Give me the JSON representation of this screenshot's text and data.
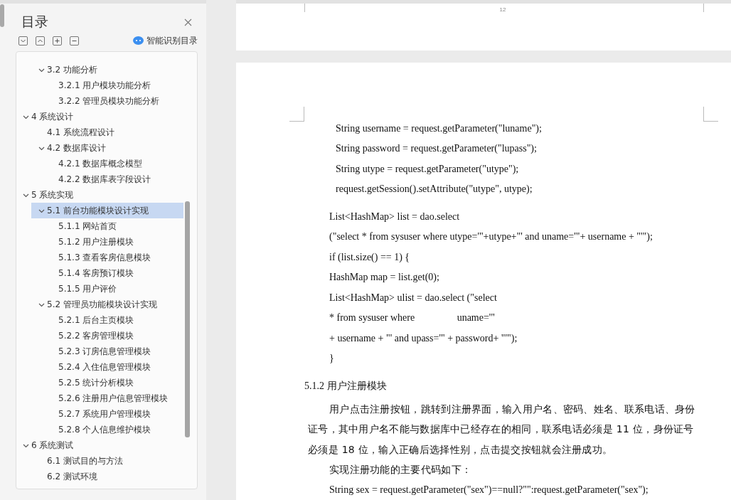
{
  "sidebar": {
    "title": "目录",
    "smart_button": "智能识别目录",
    "toc_continued": [
      {
        "label": "3.2 功能分析",
        "expanded": true,
        "selected": false,
        "children": [
          {
            "label": "3.2.1  用户模块功能分析",
            "selected": false
          },
          {
            "label": "3.2.2  管理员模块功能分析",
            "selected": false
          }
        ]
      }
    ],
    "toc": [
      {
        "label": "4 系统设计",
        "expanded": true,
        "selected": false,
        "children": [
          {
            "label": "4.1 系统流程设计",
            "selected": false
          },
          {
            "label": "4.2 数据库设计",
            "expanded": true,
            "selected": false,
            "children": [
              {
                "label": "4.2.1  数据库概念模型",
                "selected": false
              },
              {
                "label": "4.2.2  数据库表字段设计",
                "selected": false
              }
            ]
          }
        ]
      },
      {
        "label": "5 系统实现",
        "expanded": true,
        "selected": false,
        "children": [
          {
            "label": "5.1  前台功能模块设计实现",
            "expanded": true,
            "selected": true,
            "children": [
              {
                "label": "5.1.1 网站首页",
                "selected": false
              },
              {
                "label": "5.1.2 用户注册模块",
                "selected": false
              },
              {
                "label": "5.1.3 查看客房信息模块",
                "selected": false
              },
              {
                "label": "5.1.4 客房预订模块",
                "selected": false
              },
              {
                "label": "5.1.5 用户评价",
                "selected": false
              }
            ]
          },
          {
            "label": "5.2  管理员功能模块设计实现",
            "expanded": true,
            "selected": false,
            "children": [
              {
                "label": "5.2.1  后台主页模块",
                "selected": false
              },
              {
                "label": "5.2.2  客房管理模块",
                "selected": false
              },
              {
                "label": "5.2.3  订房信息管理模块",
                "selected": false
              },
              {
                "label": "5.2.4  入住信息管理模块",
                "selected": false
              },
              {
                "label": "5.2.5 统计分析模块",
                "selected": false
              },
              {
                "label": "5.2.6 注册用户信息管理模块",
                "selected": false
              },
              {
                "label": "5.2.7 系统用户管理模块",
                "selected": false
              },
              {
                "label": "5.2.8 个人信息维护模块",
                "selected": false
              }
            ]
          }
        ]
      },
      {
        "label": "6 系统测试",
        "expanded": true,
        "selected": false,
        "children": [
          {
            "label": "6.1 测试目的与方法",
            "selected": false
          },
          {
            "label": "6.2 测试环境",
            "selected": false
          }
        ]
      }
    ]
  },
  "document": {
    "page_number": "12",
    "blocks": [
      {
        "kind": "code-indented",
        "text": "String username = request.getParameter(\"luname\");"
      },
      {
        "kind": "code-indented",
        "text": "String password = request.getParameter(\"lupass\");"
      },
      {
        "kind": "code-indented",
        "text": "String utype = request.getParameter(\"utype\");"
      },
      {
        "kind": "code-indented",
        "text": "request.getSession().setAttribute(\"utype\", utype);"
      },
      {
        "kind": "code",
        "text": "List<HashMap> list = dao.select"
      },
      {
        "kind": "code",
        "text": "(\"select * from sysuser where utype='\"+utype+\"' and uname='\"+ username + \"'\");"
      },
      {
        "kind": "code",
        "text": "if (list.size() == 1) {"
      },
      {
        "kind": "code",
        "text": "HashMap map = list.get(0);"
      },
      {
        "kind": "code",
        "text": "List<HashMap> ulist = dao.select (\"select"
      },
      {
        "kind": "code",
        "text": "* from sysuser where                 uname='\""
      },
      {
        "kind": "code",
        "text": "+ username + \"' and upass='\" + password+ \"'\");"
      },
      {
        "kind": "code",
        "text": "}"
      },
      {
        "kind": "heading",
        "text": "5.1.2 用户注册模块"
      },
      {
        "kind": "paragraph",
        "text": "用户点击注册按钮，跳转到注册界面，输入用户名、密码、姓名、联系电话、身份证号，其中用户名不能与数据库中已经存在的相同，联系电话必须是 11 位，身份证号必须是 18 位，输入正确后选择性别，点击提交按钮就会注册成功。"
      },
      {
        "kind": "paragraph",
        "text": "实现注册功能的主要代码如下："
      },
      {
        "kind": "code",
        "text": "String sex = request.getParameter(\"sex\")==null?\"\":request.getParameter(\"sex\");"
      }
    ]
  }
}
